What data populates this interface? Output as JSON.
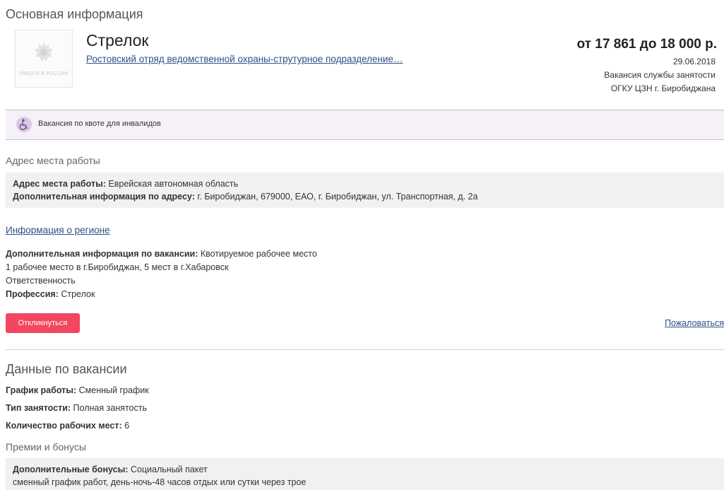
{
  "main": {
    "section_title": "Основная информация",
    "logo_text": "РАБОТА В РОССИИ",
    "job_title": "Стрелок",
    "employer": "Ростовский отряд ведомственной охраны-струтурное подразделение…",
    "salary": "от 17 861 до 18 000 р.",
    "date": "29.06.2018",
    "source": "Вакансия службы занятости",
    "agency": "ОГКУ ЦЗН г. Биробиджана"
  },
  "quota": {
    "text": "Вакансия по квоте для инвалидов",
    "accent": "#d9c9e6"
  },
  "address": {
    "title": "Адрес места работы",
    "address_label": "Адрес места работы",
    "address_value": "Еврейская автономная область",
    "extra_label": "Дополнительная информация по адресу",
    "extra_value": "г. Биробиджан, 679000, ЕАО, г. Биробиджан, ул. Транспортная, д. 2а"
  },
  "region_link": "Информация о регионе",
  "vacancy": {
    "extra_label": "Дополнительная информация по вакансии",
    "extra_value": "Квотируемое рабочее место",
    "line2": "1 рабочее место в г.Биробиджан, 5 мест в г.Хабаровск",
    "line3": "Ответственность",
    "profession_label": "Профессия",
    "profession_value": "Стрелок"
  },
  "actions": {
    "apply_label": "Откликнуться",
    "apply_color": "#f2475f",
    "complain_label": "Пожаловаться"
  },
  "data": {
    "section_title": "Данные по вакансии",
    "schedule_label": "График работы",
    "schedule_value": "Сменный график",
    "employment_label": "Тип занятости",
    "employment_value": "Полная занятость",
    "places_label": "Количество рабочих мест",
    "places_value": "6"
  },
  "bonus": {
    "title": "Премии и бонусы",
    "extra_label": "Дополнительные бонусы",
    "extra_value": "Социальный пакет",
    "line2": "сменный график работ, день-ночь-48 часов отдых или сутки через трое"
  },
  "colors": {
    "link": "#2e4f86",
    "divider": "#cfcfcf"
  }
}
